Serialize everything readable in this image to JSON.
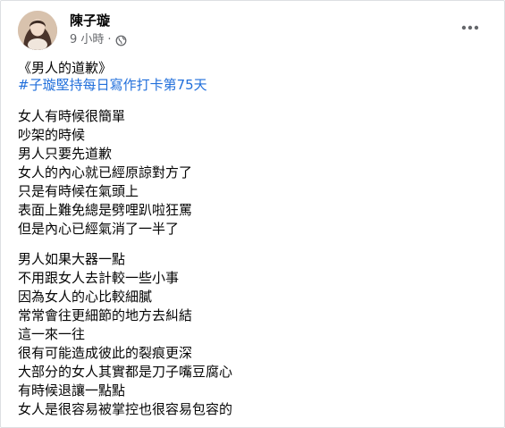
{
  "post": {
    "author": "陳子璇",
    "time": "9 小時",
    "separator": "·",
    "privacy_icon": "globe-icon",
    "more_icon": "more-horizontal-icon",
    "title": "《男人的道歉》",
    "hashtag": "#子璇堅持每日寫作打卡第75天",
    "paragraphs": [
      [
        "女人有時候很簡單",
        "吵架的時候",
        "男人只要先道歉",
        "女人的內心就已經原諒對方了",
        "只是有時候在氣頭上",
        "表面上難免總是劈哩趴啦狂罵",
        "但是內心已經氣消了一半了"
      ],
      [
        "男人如果大器一點",
        "不用跟女人去計較一些小事",
        "因為女人的心比較細膩",
        "常常會往更細節的地方去糾結",
        "這一來一往",
        "很有可能造成彼此的裂痕更深",
        "大部分的女人其實都是刀子嘴豆腐心",
        "有時候退讓一點點",
        "女人是很容易被掌控也很容易包容的"
      ]
    ]
  },
  "colors": {
    "text": "#050505",
    "secondary": "#65676b",
    "link": "#216fdb",
    "border": "#dddfe2"
  }
}
